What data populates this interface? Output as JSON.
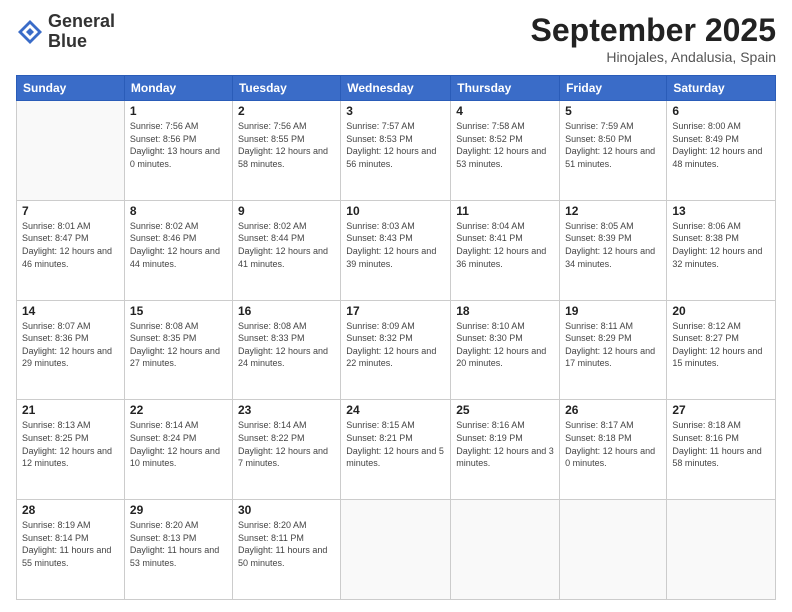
{
  "logo": {
    "line1": "General",
    "line2": "Blue"
  },
  "header": {
    "month": "September 2025",
    "location": "Hinojales, Andalusia, Spain"
  },
  "weekdays": [
    "Sunday",
    "Monday",
    "Tuesday",
    "Wednesday",
    "Thursday",
    "Friday",
    "Saturday"
  ],
  "weeks": [
    [
      {
        "day": "",
        "sunrise": "",
        "sunset": "",
        "daylight": ""
      },
      {
        "day": "1",
        "sunrise": "Sunrise: 7:56 AM",
        "sunset": "Sunset: 8:56 PM",
        "daylight": "Daylight: 13 hours and 0 minutes."
      },
      {
        "day": "2",
        "sunrise": "Sunrise: 7:56 AM",
        "sunset": "Sunset: 8:55 PM",
        "daylight": "Daylight: 12 hours and 58 minutes."
      },
      {
        "day": "3",
        "sunrise": "Sunrise: 7:57 AM",
        "sunset": "Sunset: 8:53 PM",
        "daylight": "Daylight: 12 hours and 56 minutes."
      },
      {
        "day": "4",
        "sunrise": "Sunrise: 7:58 AM",
        "sunset": "Sunset: 8:52 PM",
        "daylight": "Daylight: 12 hours and 53 minutes."
      },
      {
        "day": "5",
        "sunrise": "Sunrise: 7:59 AM",
        "sunset": "Sunset: 8:50 PM",
        "daylight": "Daylight: 12 hours and 51 minutes."
      },
      {
        "day": "6",
        "sunrise": "Sunrise: 8:00 AM",
        "sunset": "Sunset: 8:49 PM",
        "daylight": "Daylight: 12 hours and 48 minutes."
      }
    ],
    [
      {
        "day": "7",
        "sunrise": "Sunrise: 8:01 AM",
        "sunset": "Sunset: 8:47 PM",
        "daylight": "Daylight: 12 hours and 46 minutes."
      },
      {
        "day": "8",
        "sunrise": "Sunrise: 8:02 AM",
        "sunset": "Sunset: 8:46 PM",
        "daylight": "Daylight: 12 hours and 44 minutes."
      },
      {
        "day": "9",
        "sunrise": "Sunrise: 8:02 AM",
        "sunset": "Sunset: 8:44 PM",
        "daylight": "Daylight: 12 hours and 41 minutes."
      },
      {
        "day": "10",
        "sunrise": "Sunrise: 8:03 AM",
        "sunset": "Sunset: 8:43 PM",
        "daylight": "Daylight: 12 hours and 39 minutes."
      },
      {
        "day": "11",
        "sunrise": "Sunrise: 8:04 AM",
        "sunset": "Sunset: 8:41 PM",
        "daylight": "Daylight: 12 hours and 36 minutes."
      },
      {
        "day": "12",
        "sunrise": "Sunrise: 8:05 AM",
        "sunset": "Sunset: 8:39 PM",
        "daylight": "Daylight: 12 hours and 34 minutes."
      },
      {
        "day": "13",
        "sunrise": "Sunrise: 8:06 AM",
        "sunset": "Sunset: 8:38 PM",
        "daylight": "Daylight: 12 hours and 32 minutes."
      }
    ],
    [
      {
        "day": "14",
        "sunrise": "Sunrise: 8:07 AM",
        "sunset": "Sunset: 8:36 PM",
        "daylight": "Daylight: 12 hours and 29 minutes."
      },
      {
        "day": "15",
        "sunrise": "Sunrise: 8:08 AM",
        "sunset": "Sunset: 8:35 PM",
        "daylight": "Daylight: 12 hours and 27 minutes."
      },
      {
        "day": "16",
        "sunrise": "Sunrise: 8:08 AM",
        "sunset": "Sunset: 8:33 PM",
        "daylight": "Daylight: 12 hours and 24 minutes."
      },
      {
        "day": "17",
        "sunrise": "Sunrise: 8:09 AM",
        "sunset": "Sunset: 8:32 PM",
        "daylight": "Daylight: 12 hours and 22 minutes."
      },
      {
        "day": "18",
        "sunrise": "Sunrise: 8:10 AM",
        "sunset": "Sunset: 8:30 PM",
        "daylight": "Daylight: 12 hours and 20 minutes."
      },
      {
        "day": "19",
        "sunrise": "Sunrise: 8:11 AM",
        "sunset": "Sunset: 8:29 PM",
        "daylight": "Daylight: 12 hours and 17 minutes."
      },
      {
        "day": "20",
        "sunrise": "Sunrise: 8:12 AM",
        "sunset": "Sunset: 8:27 PM",
        "daylight": "Daylight: 12 hours and 15 minutes."
      }
    ],
    [
      {
        "day": "21",
        "sunrise": "Sunrise: 8:13 AM",
        "sunset": "Sunset: 8:25 PM",
        "daylight": "Daylight: 12 hours and 12 minutes."
      },
      {
        "day": "22",
        "sunrise": "Sunrise: 8:14 AM",
        "sunset": "Sunset: 8:24 PM",
        "daylight": "Daylight: 12 hours and 10 minutes."
      },
      {
        "day": "23",
        "sunrise": "Sunrise: 8:14 AM",
        "sunset": "Sunset: 8:22 PM",
        "daylight": "Daylight: 12 hours and 7 minutes."
      },
      {
        "day": "24",
        "sunrise": "Sunrise: 8:15 AM",
        "sunset": "Sunset: 8:21 PM",
        "daylight": "Daylight: 12 hours and 5 minutes."
      },
      {
        "day": "25",
        "sunrise": "Sunrise: 8:16 AM",
        "sunset": "Sunset: 8:19 PM",
        "daylight": "Daylight: 12 hours and 3 minutes."
      },
      {
        "day": "26",
        "sunrise": "Sunrise: 8:17 AM",
        "sunset": "Sunset: 8:18 PM",
        "daylight": "Daylight: 12 hours and 0 minutes."
      },
      {
        "day": "27",
        "sunrise": "Sunrise: 8:18 AM",
        "sunset": "Sunset: 8:16 PM",
        "daylight": "Daylight: 11 hours and 58 minutes."
      }
    ],
    [
      {
        "day": "28",
        "sunrise": "Sunrise: 8:19 AM",
        "sunset": "Sunset: 8:14 PM",
        "daylight": "Daylight: 11 hours and 55 minutes."
      },
      {
        "day": "29",
        "sunrise": "Sunrise: 8:20 AM",
        "sunset": "Sunset: 8:13 PM",
        "daylight": "Daylight: 11 hours and 53 minutes."
      },
      {
        "day": "30",
        "sunrise": "Sunrise: 8:20 AM",
        "sunset": "Sunset: 8:11 PM",
        "daylight": "Daylight: 11 hours and 50 minutes."
      },
      {
        "day": "",
        "sunrise": "",
        "sunset": "",
        "daylight": ""
      },
      {
        "day": "",
        "sunrise": "",
        "sunset": "",
        "daylight": ""
      },
      {
        "day": "",
        "sunrise": "",
        "sunset": "",
        "daylight": ""
      },
      {
        "day": "",
        "sunrise": "",
        "sunset": "",
        "daylight": ""
      }
    ]
  ]
}
